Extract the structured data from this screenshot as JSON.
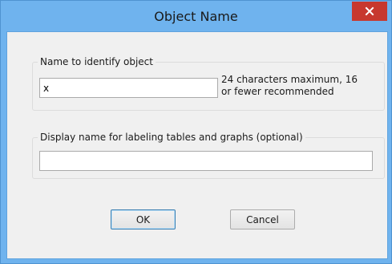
{
  "window": {
    "title": "Object Name"
  },
  "name_group": {
    "label": "Name to identify object",
    "input_value": "x",
    "hint_line1": "24 characters maximum, 16",
    "hint_line2": "or fewer recommended"
  },
  "display_group": {
    "label": "Display name for labeling tables and graphs  (optional)",
    "input_value": ""
  },
  "buttons": {
    "ok": "OK",
    "cancel": "Cancel"
  },
  "colors": {
    "frame": "#6fb3ee",
    "close": "#c7382e",
    "client": "#f0f0f0"
  },
  "icons": {
    "close": "close-icon"
  }
}
